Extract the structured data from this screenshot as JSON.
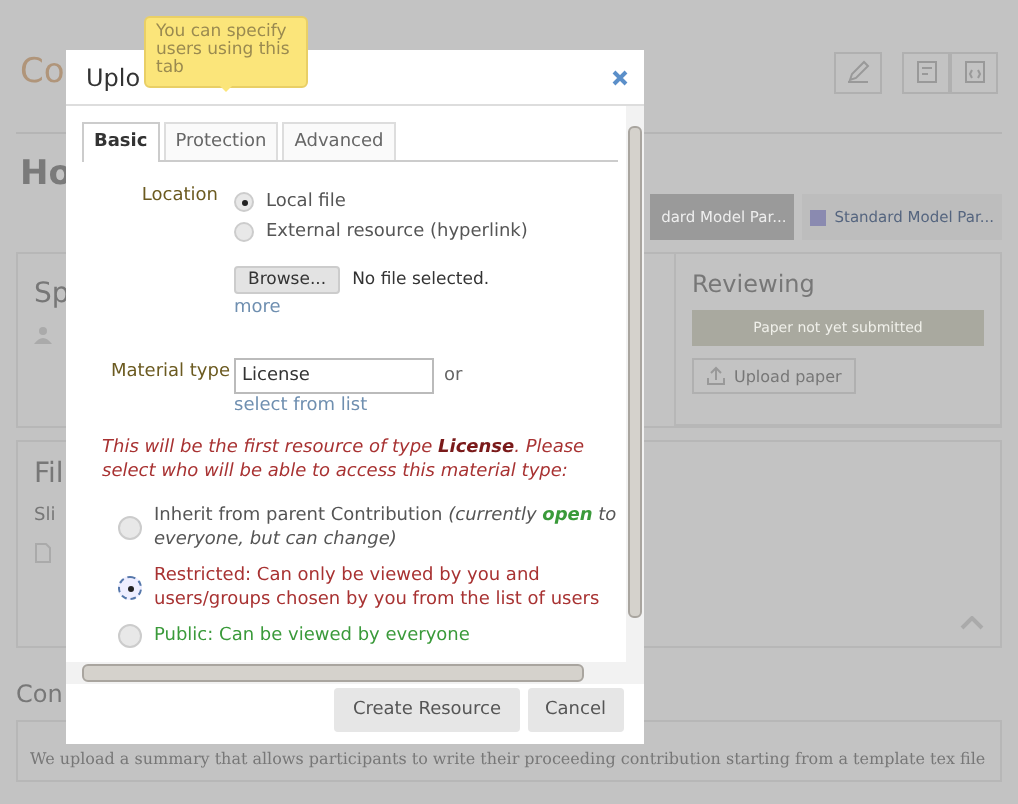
{
  "page": {
    "title": "Co",
    "heading": "Ho",
    "tabs": [
      {
        "label": "dard Model Par...",
        "selected": true
      },
      {
        "label": "Standard Model Par...",
        "selected": false,
        "color": "#8a8ab0"
      }
    ],
    "speakers_label": "Sp",
    "reviewing": {
      "title": "Reviewing",
      "status": "Paper not yet submitted",
      "upload_button": "Upload paper"
    },
    "files_label": "Fil",
    "slides_label": "Sli",
    "contribution_label": "Con",
    "summary": "We upload a summary that allows participants to write their proceeding contribution starting from a template tex file"
  },
  "dialog": {
    "title": "Uplo",
    "tooltip": "You can specify users using this tab",
    "tabs": [
      {
        "label": "Basic",
        "selected": true
      },
      {
        "label": "Protection",
        "selected": false
      },
      {
        "label": "Advanced",
        "selected": false
      }
    ],
    "location_label": "Location",
    "location_options": [
      {
        "label": "Local file",
        "selected": true
      },
      {
        "label": "External resource (hyperlink)",
        "selected": false
      }
    ],
    "browse_button": "Browse...",
    "file_status": "No file selected.",
    "more_link": "more",
    "material_type_label": "Material type",
    "material_type_value": "License",
    "or_text": "or",
    "select_link": "select from list",
    "notice": "This will be the first resource of type **License**. Please select who will be able to access this material type:",
    "access_options": [
      {
        "kind": "inherit",
        "label": "Inherit from parent Contribution",
        "note": "(currently **open** to everyone, but can change)",
        "selected": false,
        "color": "#555555"
      },
      {
        "kind": "plain",
        "label": "Restricted: Can only be viewed by you and users/groups chosen by you from the list of users",
        "selected": true,
        "color": "#a83232"
      },
      {
        "kind": "plain",
        "label": "Public: Can be viewed by everyone",
        "selected": false,
        "color": "#3a9a3a"
      }
    ],
    "buttons": [
      "Create Resource",
      "Cancel"
    ]
  }
}
